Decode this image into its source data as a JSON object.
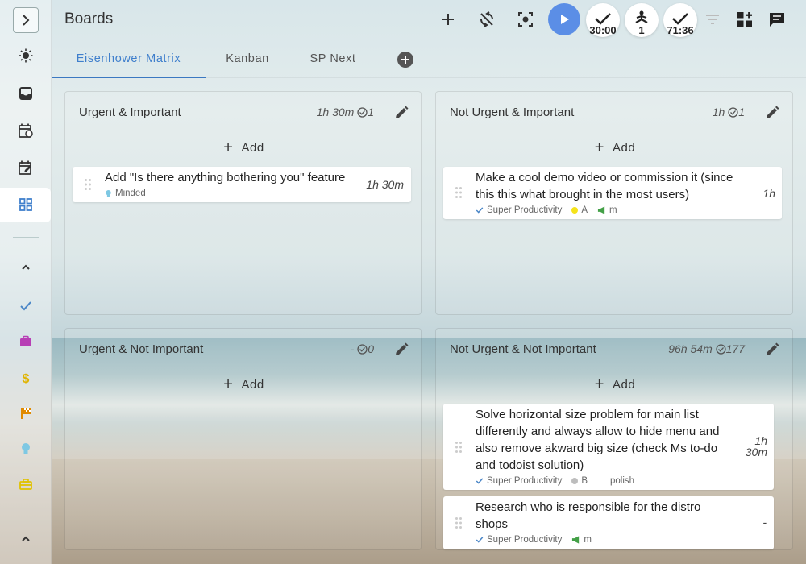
{
  "header": {
    "title": "Boards"
  },
  "counters": [
    {
      "value": "30:00"
    },
    {
      "value": "1"
    },
    {
      "value": "71:36"
    }
  ],
  "tabs": [
    {
      "label": "Eisenhower Matrix"
    },
    {
      "label": "Kanban"
    },
    {
      "label": "SP Next"
    }
  ],
  "panels": [
    {
      "title": "Urgent & Important",
      "estimate": "1h 30m",
      "count": "1",
      "add_label": "Add",
      "tasks": [
        {
          "title": "Add \"Is there anything bothering you\" feature",
          "time": "1h 30m",
          "tags": [
            {
              "label": "Minded",
              "icon": "lightbulb-icon",
              "color": "#7ec8e3"
            }
          ]
        }
      ]
    },
    {
      "title": "Not Urgent & Important",
      "estimate": "1h",
      "count": "1",
      "add_label": "Add",
      "tasks": [
        {
          "title": "Make a cool demo video or commission it (since this this what brought in the most users)",
          "time": "1h",
          "tags": [
            {
              "label": "Super Productivity",
              "icon": "check-icon",
              "color": "#4a86c7"
            },
            {
              "label": "A",
              "icon": "dot",
              "color": "#f5e31b"
            },
            {
              "label": "m",
              "icon": "megaphone-icon",
              "color": "#43a047"
            }
          ]
        }
      ]
    },
    {
      "title": "Urgent & Not Important",
      "estimate": "-",
      "count": "0",
      "add_label": "Add",
      "tasks": []
    },
    {
      "title": "Not Urgent & Not Important",
      "estimate": "96h 54m",
      "count": "177",
      "add_label": "Add",
      "tasks": [
        {
          "title": "Solve horizontal size problem for main list differently and always allow to hide menu and also remove akward big size (check Ms to-do and todoist solution)",
          "time_line1": "1h",
          "time_line2": "30m",
          "tags": [
            {
              "label": "Super Productivity",
              "icon": "check-icon",
              "color": "#4a86c7"
            },
            {
              "label": "B",
              "icon": "dot",
              "color": "#bdbdbd"
            },
            {
              "label": "polish",
              "icon": "none",
              "color": "#999999"
            }
          ]
        },
        {
          "title": "Research who is responsible for the distro shops",
          "time": "-",
          "tags": [
            {
              "label": "Super Productivity",
              "icon": "check-icon",
              "color": "#4a86c7"
            },
            {
              "label": "m",
              "icon": "megaphone-icon",
              "color": "#43a047"
            }
          ]
        }
      ]
    }
  ],
  "colors": {
    "accent": "#3f7fcc",
    "play": "#5b8ee6"
  }
}
